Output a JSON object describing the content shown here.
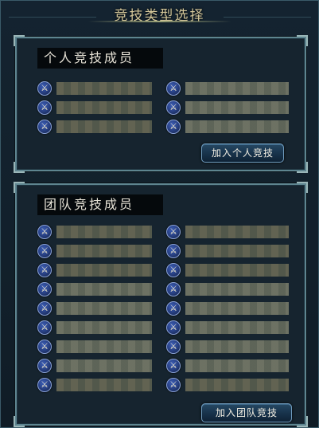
{
  "window": {
    "title": "竞技类型选择"
  },
  "individual": {
    "label": "个人竞技成员",
    "join_button": "加入个人竞技",
    "slots_per_column": 3,
    "columns": 2
  },
  "team": {
    "label": "团队竞技成员",
    "join_button": "加入团队竞技",
    "slots_per_column": 9,
    "columns": 2
  },
  "icons": {
    "slot": "sword-badge-icon"
  },
  "colors": {
    "title": "#d4c79a",
    "panel_border": "#5e8590",
    "button_border": "#6f9bbd"
  }
}
